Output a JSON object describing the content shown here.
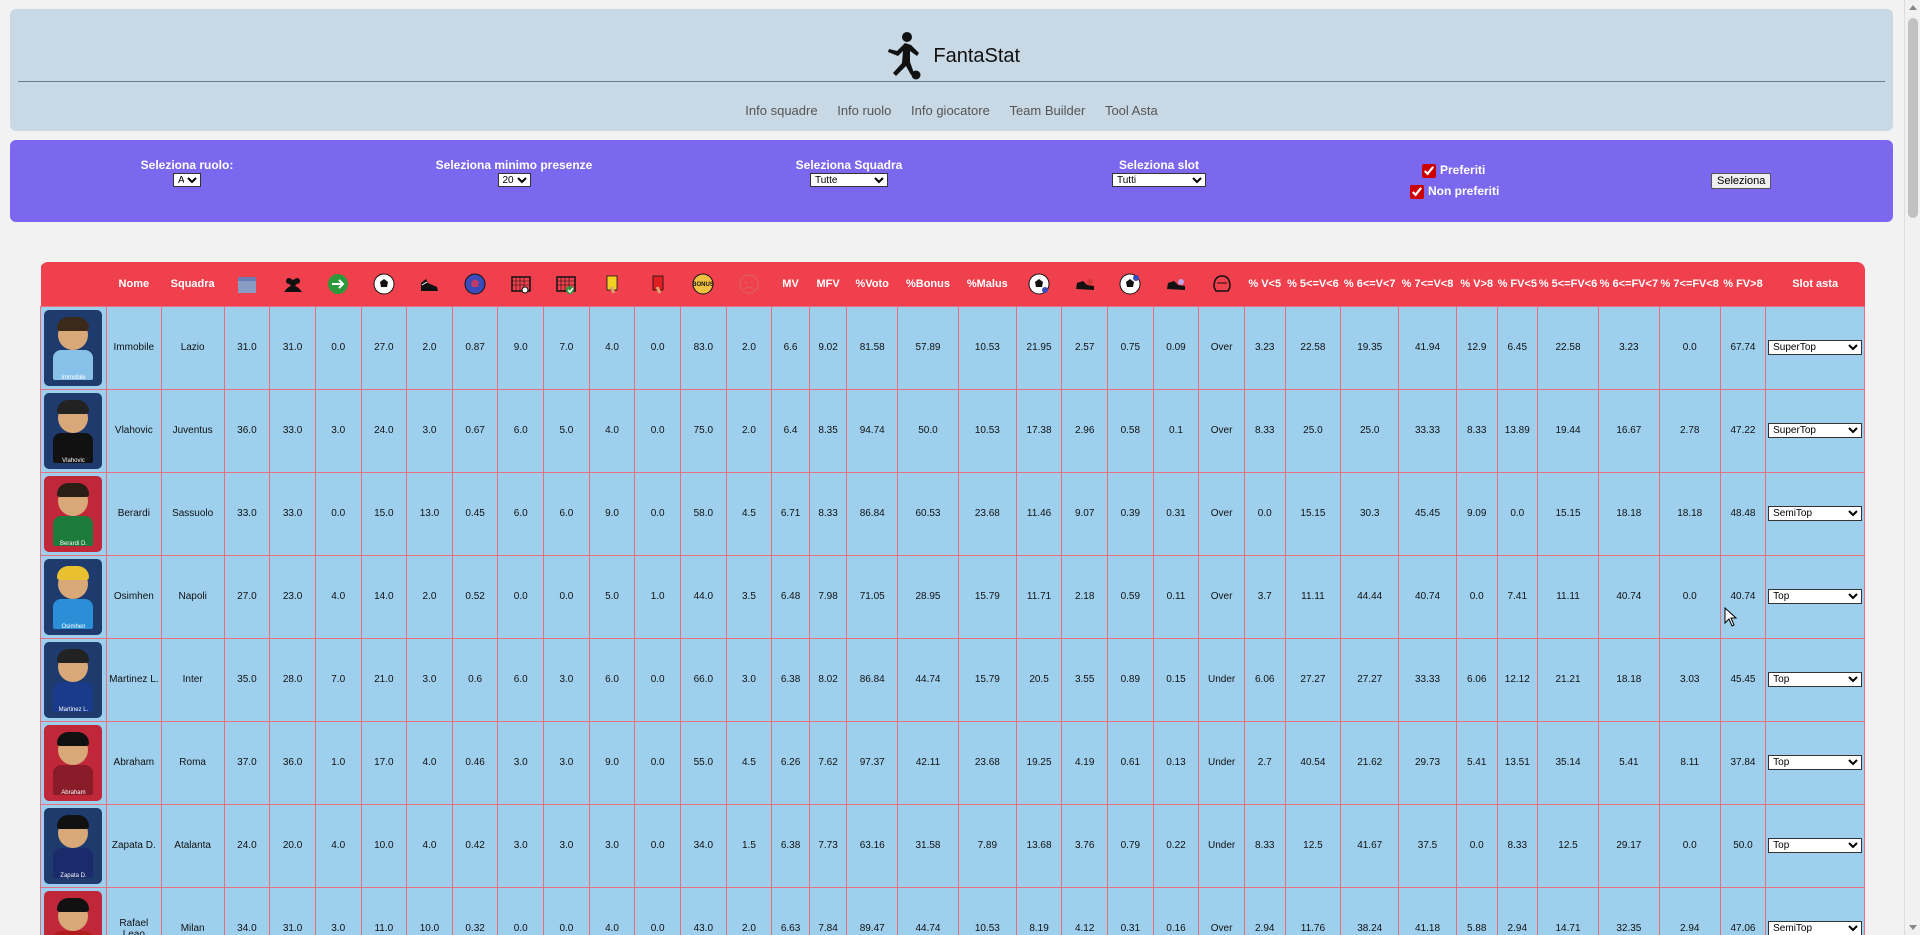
{
  "brand": {
    "title": "FantaStat"
  },
  "nav": [
    "Info squadre",
    "Info ruolo",
    "Info giocatore",
    "Team Builder",
    "Tool Asta"
  ],
  "filters": {
    "ruolo": {
      "label": "Seleziona ruolo:",
      "value": "A"
    },
    "presenze": {
      "label": "Seleziona minimo presenze",
      "value": "20"
    },
    "squadra": {
      "label": "Seleziona Squadra",
      "value": "Tutte"
    },
    "slot": {
      "label": "Seleziona slot",
      "value": "Tutti"
    },
    "preferiti": {
      "label": "Preferiti",
      "checked": true
    },
    "non_preferiti": {
      "label": "Non preferiti",
      "checked": true
    },
    "submit": "Seleziona"
  },
  "table": {
    "columns": [
      {
        "label": "",
        "icon": "player-card"
      },
      {
        "label": "Nome"
      },
      {
        "label": "Squadra"
      },
      {
        "label": "",
        "icon": "calendar-icon"
      },
      {
        "label": "",
        "icon": "people-icon"
      },
      {
        "label": "",
        "icon": "substitution-icon"
      },
      {
        "label": "",
        "icon": "ball-icon"
      },
      {
        "label": "",
        "icon": "boot-icon"
      },
      {
        "label": "",
        "icon": "penalty-ball-icon"
      },
      {
        "label": "",
        "icon": "goal-net-icon"
      },
      {
        "label": "",
        "icon": "goal-net-check-icon"
      },
      {
        "label": "",
        "icon": "yellow-card-icon"
      },
      {
        "label": "",
        "icon": "red-card-icon"
      },
      {
        "label": "",
        "icon": "bonus-icon"
      },
      {
        "label": "",
        "icon": "sad-face-icon"
      },
      {
        "label": "MV"
      },
      {
        "label": "MFV"
      },
      {
        "label": "%Voto"
      },
      {
        "label": "%Bonus"
      },
      {
        "label": "%Malus"
      },
      {
        "label": "",
        "icon": "ball-per-icon"
      },
      {
        "label": "",
        "icon": "shoe-per-icon"
      },
      {
        "label": "",
        "icon": "ball-avg-icon"
      },
      {
        "label": "",
        "icon": "shoe-avg-icon"
      },
      {
        "label": "",
        "icon": "helmet-icon"
      },
      {
        "label": "% V<5"
      },
      {
        "label": "% 5<=V<6"
      },
      {
        "label": "% 6<=V<7"
      },
      {
        "label": "% 7<=V<8"
      },
      {
        "label": "% V>8"
      },
      {
        "label": "% FV<5"
      },
      {
        "label": "% 5<=FV<6"
      },
      {
        "label": "% 6<=FV<7"
      },
      {
        "label": "% 7<=FV<8"
      },
      {
        "label": "% FV>8"
      },
      {
        "label": "Slot asta"
      }
    ],
    "rows": [
      {
        "nome": "Immobile",
        "squadra": "Lazio",
        "card": "Immobile",
        "card_color": "#1f3b6e",
        "hair": "#3b2a1a",
        "kit": "#87c1ea",
        "values": [
          "31.0",
          "31.0",
          "0.0",
          "27.0",
          "2.0",
          "0.87",
          "9.0",
          "7.0",
          "4.0",
          "0.0",
          "83.0",
          "2.0",
          "6.6",
          "9.02",
          "81.58",
          "57.89",
          "10.53",
          "21.95",
          "2.57",
          "0.75",
          "0.09",
          "Over",
          "3.23",
          "22.58",
          "19.35",
          "41.94",
          "12.9",
          "6.45",
          "22.58",
          "3.23",
          "0.0",
          "67.74"
        ],
        "slot": "SuperTop"
      },
      {
        "nome": "Vlahovic",
        "squadra": "Juventus",
        "card": "Vlahovic",
        "card_color": "#1f3b6e",
        "hair": "#222",
        "kit": "#111",
        "values": [
          "36.0",
          "33.0",
          "3.0",
          "24.0",
          "3.0",
          "0.67",
          "6.0",
          "5.0",
          "4.0",
          "0.0",
          "75.0",
          "2.0",
          "6.4",
          "8.35",
          "94.74",
          "50.0",
          "10.53",
          "17.38",
          "2.96",
          "0.58",
          "0.1",
          "Over",
          "8.33",
          "25.0",
          "25.0",
          "33.33",
          "8.33",
          "13.89",
          "19.44",
          "16.67",
          "2.78",
          "47.22"
        ],
        "slot": "SuperTop"
      },
      {
        "nome": "Berardi",
        "squadra": "Sassuolo",
        "card": "Berardi D.",
        "card_color": "#c0283a",
        "hair": "#2a1e15",
        "kit": "#1c7a3a",
        "values": [
          "33.0",
          "33.0",
          "0.0",
          "15.0",
          "13.0",
          "0.45",
          "6.0",
          "6.0",
          "9.0",
          "0.0",
          "58.0",
          "4.5",
          "6.71",
          "8.33",
          "86.84",
          "60.53",
          "23.68",
          "11.46",
          "9.07",
          "0.39",
          "0.31",
          "Over",
          "0.0",
          "15.15",
          "30.3",
          "45.45",
          "9.09",
          "0.0",
          "15.15",
          "18.18",
          "18.18",
          "48.48"
        ],
        "slot": "SemiTop"
      },
      {
        "nome": "Osimhen",
        "squadra": "Napoli",
        "card": "Osimhen",
        "card_color": "#1f3b6e",
        "hair": "#e8c030",
        "kit": "#2a8fd6",
        "values": [
          "27.0",
          "23.0",
          "4.0",
          "14.0",
          "2.0",
          "0.52",
          "0.0",
          "0.0",
          "5.0",
          "1.0",
          "44.0",
          "3.5",
          "6.48",
          "7.98",
          "71.05",
          "28.95",
          "15.79",
          "11.71",
          "2.18",
          "0.59",
          "0.11",
          "Over",
          "3.7",
          "11.11",
          "44.44",
          "40.74",
          "0.0",
          "7.41",
          "11.11",
          "40.74",
          "0.0",
          "40.74"
        ],
        "slot": "Top"
      },
      {
        "nome": "Martinez L.",
        "squadra": "Inter",
        "card": "Martinez L.",
        "card_color": "#1f3b6e",
        "hair": "#222",
        "kit": "#1a3a8a",
        "values": [
          "35.0",
          "28.0",
          "7.0",
          "21.0",
          "3.0",
          "0.6",
          "6.0",
          "3.0",
          "6.0",
          "0.0",
          "66.0",
          "3.0",
          "6.38",
          "8.02",
          "86.84",
          "44.74",
          "15.79",
          "20.5",
          "3.55",
          "0.89",
          "0.15",
          "Under",
          "6.06",
          "27.27",
          "27.27",
          "33.33",
          "6.06",
          "12.12",
          "21.21",
          "18.18",
          "3.03",
          "45.45"
        ],
        "slot": "Top"
      },
      {
        "nome": "Abraham",
        "squadra": "Roma",
        "card": "Abraham",
        "card_color": "#c0283a",
        "hair": "#111",
        "kit": "#8a1c2a",
        "values": [
          "37.0",
          "36.0",
          "1.0",
          "17.0",
          "4.0",
          "0.46",
          "3.0",
          "3.0",
          "9.0",
          "0.0",
          "55.0",
          "4.5",
          "6.26",
          "7.62",
          "97.37",
          "42.11",
          "23.68",
          "19.25",
          "4.19",
          "0.61",
          "0.13",
          "Under",
          "2.7",
          "40.54",
          "21.62",
          "29.73",
          "5.41",
          "13.51",
          "35.14",
          "5.41",
          "8.11",
          "37.84"
        ],
        "slot": "Top"
      },
      {
        "nome": "Zapata D.",
        "squadra": "Atalanta",
        "card": "Zapata D.",
        "card_color": "#1f3b6e",
        "hair": "#111",
        "kit": "#1a2a6a",
        "values": [
          "24.0",
          "20.0",
          "4.0",
          "10.0",
          "4.0",
          "0.42",
          "3.0",
          "3.0",
          "3.0",
          "0.0",
          "34.0",
          "1.5",
          "6.38",
          "7.73",
          "63.16",
          "31.58",
          "7.89",
          "13.68",
          "3.76",
          "0.79",
          "0.22",
          "Under",
          "8.33",
          "12.5",
          "41.67",
          "37.5",
          "0.0",
          "8.33",
          "12.5",
          "29.17",
          "0.0",
          "50.0"
        ],
        "slot": "Top"
      },
      {
        "nome": "Rafael Leao",
        "squadra": "Milan",
        "card": "Rafael Leao",
        "card_color": "#c0283a",
        "hair": "#111",
        "kit": "#b01c1c",
        "values": [
          "34.0",
          "31.0",
          "3.0",
          "11.0",
          "10.0",
          "0.32",
          "0.0",
          "0.0",
          "4.0",
          "0.0",
          "43.0",
          "2.0",
          "6.63",
          "7.84",
          "89.47",
          "44.74",
          "10.53",
          "8.19",
          "4.12",
          "0.31",
          "0.16",
          "Over",
          "2.94",
          "11.76",
          "38.24",
          "41.18",
          "5.88",
          "2.94",
          "14.71",
          "32.35",
          "2.94",
          "47.06"
        ],
        "slot": "SemiTop"
      }
    ],
    "slot_options": [
      "SuperTop",
      "Top",
      "SemiTop"
    ]
  }
}
